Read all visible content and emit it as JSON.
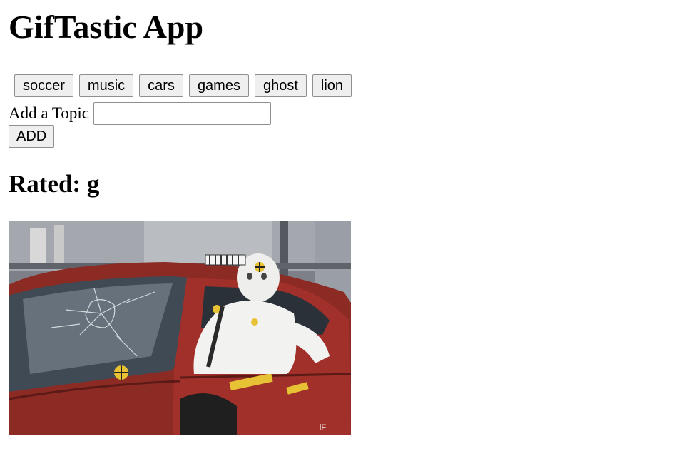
{
  "header": {
    "title": "GifTastic App"
  },
  "topics": [
    {
      "label": "soccer"
    },
    {
      "label": "music"
    },
    {
      "label": "cars"
    },
    {
      "label": "games"
    },
    {
      "label": "ghost"
    },
    {
      "label": "lion"
    }
  ],
  "add_form": {
    "label": "Add a Topic",
    "input_value": "",
    "button_label": "ADD"
  },
  "results": [
    {
      "rating_prefix": "Rated: g",
      "watermark": "iF"
    }
  ]
}
